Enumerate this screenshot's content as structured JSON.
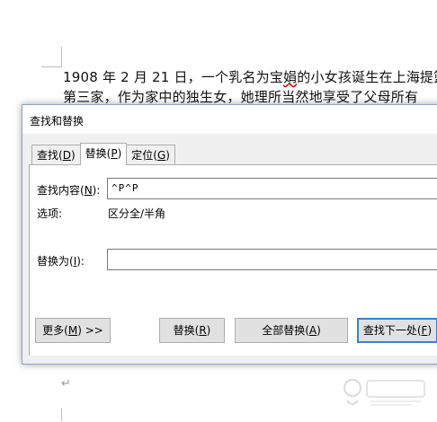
{
  "document": {
    "line1_prefix": "1908 年 2 月 21 日，一个乳名为宝",
    "line1_error": "娟",
    "line1_suffix": "的小女孩诞生在上海提篮",
    "line2": "第三家，作为家中的独生女，她理所当然地享受了父母所有",
    "paragraph_mark": "↵"
  },
  "dialog": {
    "title": "查找和替换",
    "tabs": [
      {
        "label": "查找(",
        "key": "D",
        "suffix": ")",
        "active": false
      },
      {
        "label": "替换(",
        "key": "P",
        "suffix": ")",
        "active": true
      },
      {
        "label": "定位(",
        "key": "G",
        "suffix": ")",
        "active": false
      }
    ],
    "find": {
      "label": "查找内容(",
      "key": "N",
      "suffix": "):",
      "value": "^P^P"
    },
    "options": {
      "label": "选项:",
      "value": "区分全/半角"
    },
    "replace": {
      "label": "替换为(",
      "key": "I",
      "suffix": "):",
      "value": ""
    },
    "buttons": {
      "more": {
        "label": "更多(",
        "key": "M",
        "suffix": ") >>"
      },
      "replace": {
        "label": "替换(",
        "key": "R",
        "suffix": ")"
      },
      "replace_all": {
        "label": "全部替换(",
        "key": "A",
        "suffix": ")"
      },
      "find_next": {
        "label": "查找下一处(",
        "key": "F",
        "suffix": ")"
      }
    }
  },
  "colors": {
    "default_button_border": "#3d7fd0",
    "dialog_bg": "#f0f0f0",
    "spell_error": "#d00000"
  }
}
